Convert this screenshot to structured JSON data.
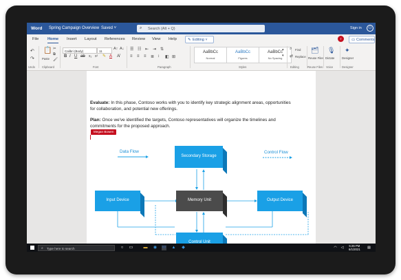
{
  "titlebar": {
    "app_name": "Word",
    "doc_title": "Spring Campaign Overview",
    "saved_status": "Saved ˅",
    "search_placeholder": "Search (Alt + Q)",
    "sign_in": "Sign in"
  },
  "tabs": [
    "File",
    "Home",
    "Insert",
    "Layout",
    "References",
    "Review",
    "View",
    "Help"
  ],
  "mode_button": "Editing ˅",
  "comments_button": "Comments",
  "ribbon": {
    "undo_label": "Undo",
    "paste_label": "Paste",
    "clipboard_label": "Clipboard",
    "font_name": "Calibri (Body)",
    "font_size": "11",
    "font_label": "Font",
    "paragraph_label": "Paragraph",
    "styles": [
      {
        "preview": "AaBbCc",
        "name": "Normal"
      },
      {
        "preview": "AaBbCc",
        "name": "Figures"
      },
      {
        "preview": "AaBbCc",
        "name": "No Spacing"
      }
    ],
    "styles_label": "Styles",
    "find_label": "Find",
    "replace_label": "Replace",
    "editing_label": "Editing",
    "reuse_files_label": "Reuse Files",
    "dictate_label": "Dictate",
    "voice_label": "Voice",
    "designer_label": "Designer"
  },
  "document": {
    "para1_bold": "Evaluate:",
    "para1_line1": " In this phase, Contoso works with you to identify key strategic alignment areas, opportunities",
    "para1_line2": "for collaboration, and potential new offerings.",
    "para2_bold": "Plan:",
    "para2_line1": " Once we've identified the targets, Contoso representatives will organize the timelines and",
    "para2_line2": "commitments for the proposed approach.",
    "collaborator_name": "Megan Bowen"
  },
  "diagram": {
    "data_flow_label": "Data Flow",
    "control_flow_label": "Control Flow",
    "secondary_storage": "Secondary Storage",
    "input_device": "Input Device",
    "memory_unit": "Memory Unit",
    "output_device": "Output Device",
    "control_unit": "Control Unit"
  },
  "taskbar": {
    "search_placeholder": "Type here to search",
    "time": "5:26 PM",
    "date": "6/1/2021"
  },
  "colors": {
    "word_blue": "#2b579a",
    "box_blue": "#1aa0e6",
    "memory_gray": "#4b4b4b",
    "collaborator_red": "#c50f1f"
  }
}
